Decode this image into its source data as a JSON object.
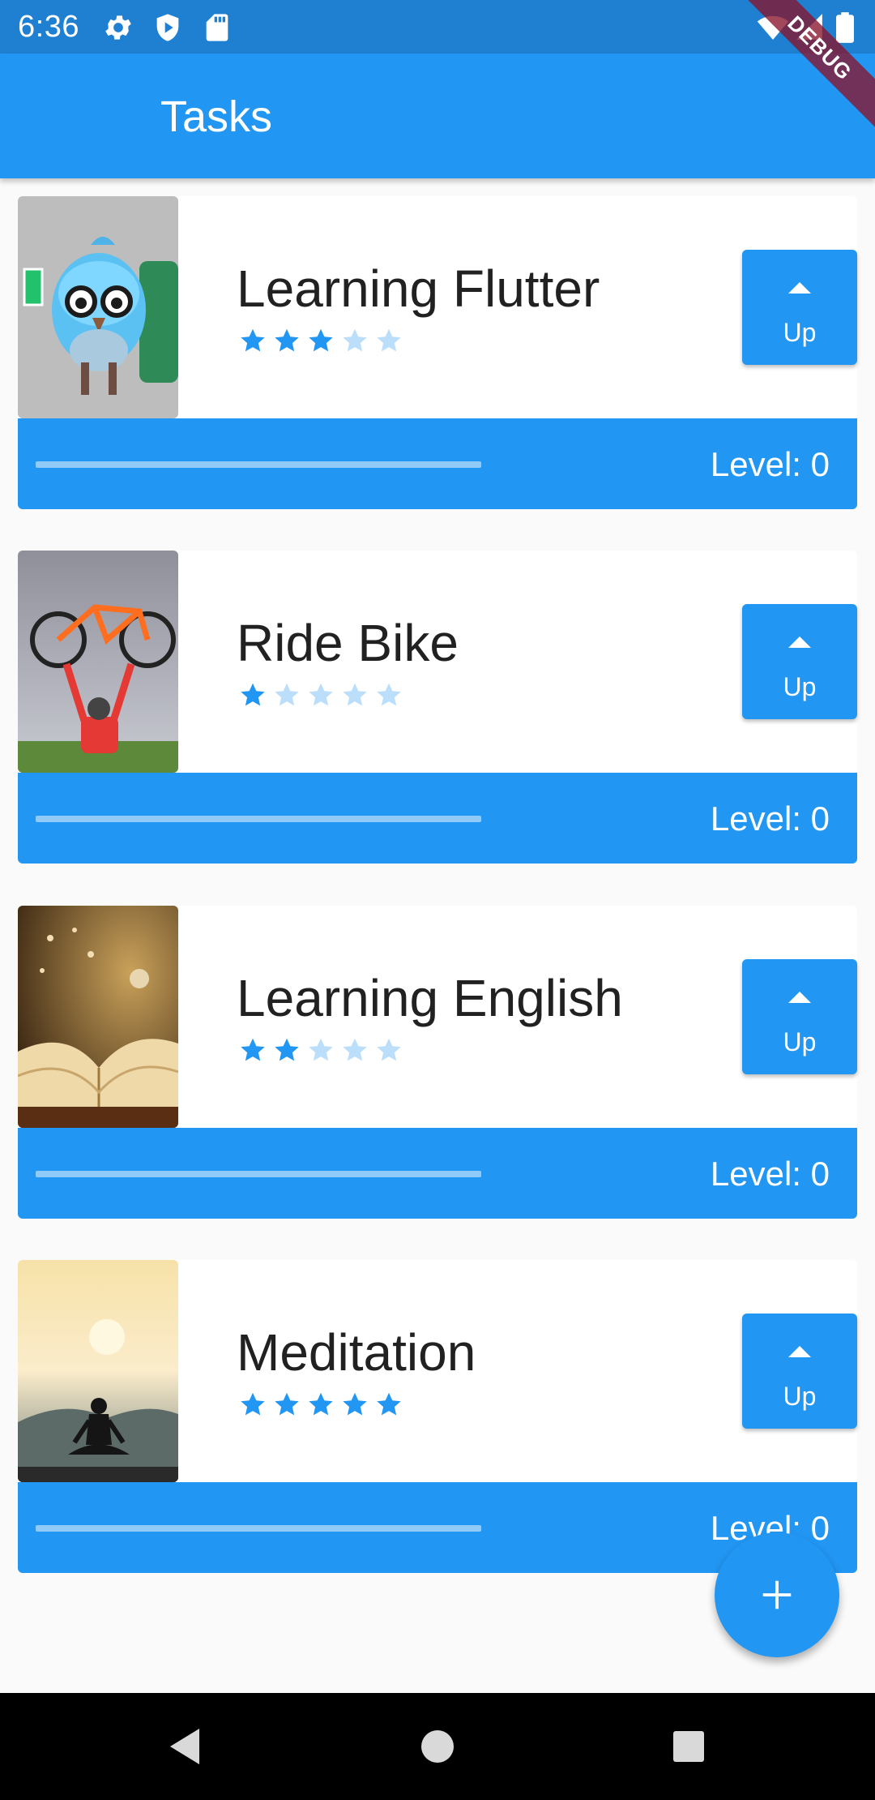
{
  "status_bar": {
    "time": "6:36",
    "left_icons": [
      "gear-icon",
      "shield-icon",
      "sd-card-icon"
    ],
    "right_icons": [
      "wifi-icon",
      "signal-icon",
      "battery-icon"
    ]
  },
  "debug_banner": "DEBUG",
  "app_bar": {
    "title": "Tasks"
  },
  "colors": {
    "primary": "#2196f3",
    "status_bar": "#1f7fd1",
    "star_filled": "#2196f3",
    "star_empty": "#bbdefb",
    "progress_track": "#90caf9"
  },
  "tasks": [
    {
      "name": "Learning Flutter",
      "difficulty": 3,
      "max_stars": 5,
      "up_label": "Up",
      "level_label": "Level: 0",
      "progress": 0
    },
    {
      "name": "Ride Bike",
      "difficulty": 1,
      "max_stars": 5,
      "up_label": "Up",
      "level_label": "Level: 0",
      "progress": 0
    },
    {
      "name": "Learning English",
      "difficulty": 2,
      "max_stars": 5,
      "up_label": "Up",
      "level_label": "Level: 0",
      "progress": 0
    },
    {
      "name": "Meditation",
      "difficulty": 5,
      "max_stars": 5,
      "up_label": "Up",
      "level_label": "Level: 0",
      "progress": 0
    }
  ],
  "fab": {
    "icon": "plus-icon"
  },
  "nav_bar": {
    "buttons": [
      "back-icon",
      "home-icon",
      "recents-icon"
    ]
  }
}
